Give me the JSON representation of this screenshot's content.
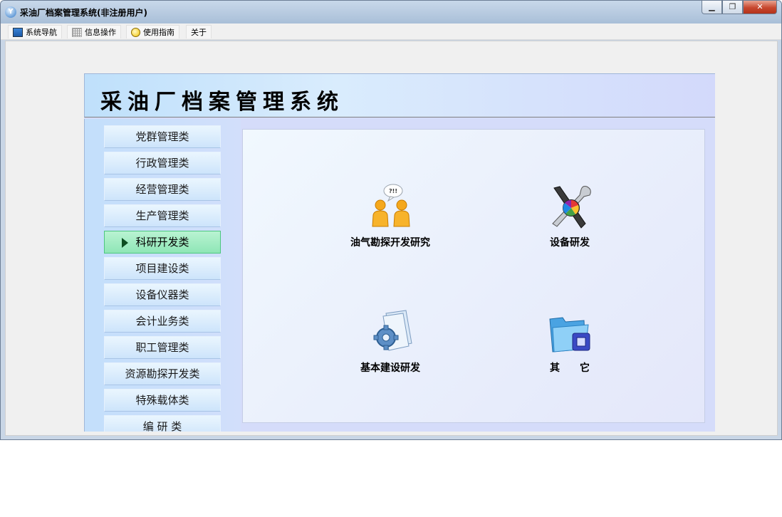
{
  "window": {
    "title": "采油厂档案管理系统(非注册用户)",
    "controls": {
      "minimize": "▁",
      "maximize": "❐",
      "close": "✕"
    }
  },
  "menubar": {
    "items": [
      {
        "label": "系统导航",
        "icon": "monitor-icon"
      },
      {
        "label": "信息操作",
        "icon": "grid-icon"
      },
      {
        "label": "使用指南",
        "icon": "bulb-icon"
      },
      {
        "label": "关于",
        "icon": ""
      }
    ]
  },
  "banner": {
    "title": "采油厂档案管理系统"
  },
  "sidebar": {
    "items": [
      {
        "label": "党群管理类"
      },
      {
        "label": "行政管理类"
      },
      {
        "label": "经营管理类"
      },
      {
        "label": "生产管理类"
      },
      {
        "label": "科研开发类",
        "active": true
      },
      {
        "label": "项目建设类"
      },
      {
        "label": "设备仪器类"
      },
      {
        "label": "会计业务类"
      },
      {
        "label": "职工管理类"
      },
      {
        "label": "资源勘探开发类"
      },
      {
        "label": "特殊载体类"
      },
      {
        "label": "编 研 类"
      }
    ]
  },
  "main": {
    "tiles": [
      {
        "label": "油气勘探开发研究",
        "icon": "discussion-people-icon",
        "bubble": "?!!"
      },
      {
        "label": "设备研发",
        "icon": "tools-icon"
      },
      {
        "label": "基本建设研发",
        "icon": "gear-document-icon"
      },
      {
        "label": "其　　它",
        "icon": "folder-icon"
      }
    ]
  },
  "colors": {
    "active_item": "#8fe6b6",
    "active_arrow": "#0b4d20",
    "banner": "#d9ecfd",
    "close_button": "#c7472e"
  }
}
